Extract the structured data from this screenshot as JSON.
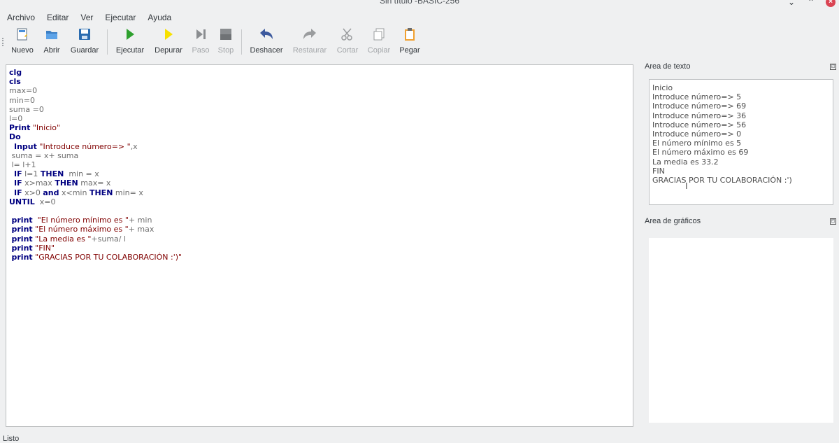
{
  "window": {
    "title": "Sin título -BASIC-256",
    "minimize_glyph": "⌄",
    "maximize_glyph": "⌃",
    "close_glyph": "×"
  },
  "menu": [
    {
      "label": "Archivo"
    },
    {
      "label": "Editar"
    },
    {
      "label": "Ver"
    },
    {
      "label": "Ejecutar"
    },
    {
      "label": "Ayuda"
    }
  ],
  "toolbar": {
    "nuevo": "Nuevo",
    "abrir": "Abrir",
    "guardar": "Guardar",
    "ejecutar": "Ejecutar",
    "depurar": "Depurar",
    "paso": "Paso",
    "stop": "Stop",
    "deshacer": "Deshacer",
    "restaurar": "Restaurar",
    "cortar": "Cortar",
    "copiar": "Copiar",
    "pegar": "Pegar"
  },
  "code": {
    "l1_kw": "clg",
    "l2_kw": "cls",
    "l3": "max=0",
    "l4": "min=0",
    "l5": "suma =0",
    "l6": "l=0",
    "l7_kw": "Print",
    "l7_str": "\"Inicio\"",
    "l8_kw": "Do",
    "l9_kw": "Input",
    "l9_str": "\"Introduce número=> \"",
    "l9_rest": ",x",
    "l10": " suma = x+ suma",
    "l11": " l= l+1",
    "l12_kw1": "IF",
    "l12_mid": "l=1",
    "l12_kw2": "THEN",
    "l12_rest": "  min = x",
    "l13_kw1": "IF",
    "l13_mid": "x>max",
    "l13_kw2": "THEN",
    "l13_rest": "max= x",
    "l14_kw1": "IF",
    "l14_mid1": "x>0",
    "l14_kw2": "and",
    "l14_mid2": "x<min",
    "l14_kw3": "THEN",
    "l14_rest": "min= x",
    "l15_kw": "UNTIL",
    "l15_rest": "  x=0",
    "l17_kw": "print",
    "l17_str": "\"El número mínimo es \"",
    "l17_rest": "+ min",
    "l18_kw": "print",
    "l18_str": "\"El número máximo es \"",
    "l18_rest": "+ max",
    "l19_kw": "print",
    "l19_str": "\"La media es \"",
    "l19_rest": "+suma/ l",
    "l20_kw": "print",
    "l20_str": "\"FIN\"",
    "l21_kw": "print",
    "l21_str": "\"GRACIAS POR TU COLABORACIÓN :')\""
  },
  "text_panel": {
    "title": "Area de texto",
    "lines": [
      "Inicio",
      "Introduce número=> 5",
      "Introduce número=> 69",
      "Introduce número=> 36",
      "Introduce número=> 56",
      "Introduce número=> 0",
      "El número mínimo es 5",
      "El número máximo es 69",
      "La media es 33.2",
      "FIN",
      "GRACIAS POR TU COLABORACIÓN :')"
    ]
  },
  "graphics_panel": {
    "title": "Area de gráficos"
  },
  "status": {
    "text": "Listo"
  },
  "colors": {
    "keyword": "#000080",
    "string": "#800000",
    "run_green": "#2ea02e",
    "close_red": "#da4453"
  }
}
